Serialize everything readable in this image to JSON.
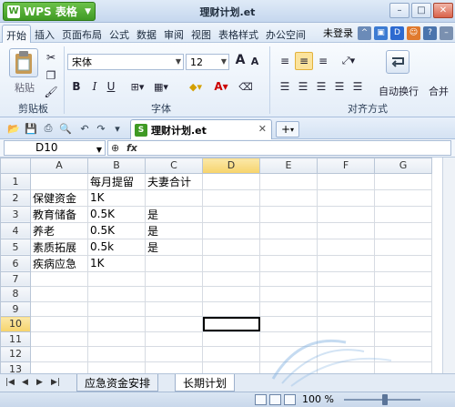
{
  "app": {
    "name": "WPS 表格",
    "window_title": "理财计划.et"
  },
  "menu": {
    "tabs": [
      "开始",
      "插入",
      "页面布局",
      "公式",
      "数据",
      "审阅",
      "视图",
      "表格样式",
      "办公空间"
    ],
    "active_tab": "开始",
    "login_label": "未登录"
  },
  "ribbon": {
    "clipboard": {
      "paste_label": "粘贴",
      "group_label": "剪贴板"
    },
    "font": {
      "font_name": "宋体",
      "font_size": "12",
      "group_label": "字体",
      "bold": "B",
      "italic": "I",
      "underline": "U",
      "grow": "A",
      "shrink": "A"
    },
    "alignment": {
      "wrap_label": "自动换行",
      "merge_label": "合并",
      "group_label": "对齐方式"
    }
  },
  "document_tab": {
    "name": "理财计划.et",
    "add_symbol": "+"
  },
  "formula_bar": {
    "cell_ref": "D10",
    "fx": "fx"
  },
  "sheet": {
    "columns": [
      "A",
      "B",
      "C",
      "D",
      "E",
      "F",
      "G"
    ],
    "rows": [
      [
        "",
        "每月提留",
        "夫妻合计",
        "",
        "",
        "",
        ""
      ],
      [
        "保健资金",
        "1K",
        "",
        "",
        "",
        "",
        ""
      ],
      [
        "教育储备",
        "0.5K",
        "是",
        "",
        "",
        "",
        ""
      ],
      [
        "养老",
        "0.5K",
        "是",
        "",
        "",
        "",
        ""
      ],
      [
        "素质拓展",
        "0.5k",
        "是",
        "",
        "",
        "",
        ""
      ],
      [
        "疾病应急",
        "1K",
        "",
        "",
        "",
        "",
        ""
      ],
      [
        "",
        "",
        "",
        "",
        "",
        "",
        ""
      ],
      [
        "",
        "",
        "",
        "",
        "",
        "",
        ""
      ],
      [
        "",
        "",
        "",
        "",
        "",
        "",
        ""
      ],
      [
        "",
        "",
        "",
        "",
        "",
        "",
        ""
      ],
      [
        "",
        "",
        "",
        "",
        "",
        "",
        ""
      ],
      [
        "",
        "",
        "",
        "",
        "",
        "",
        ""
      ],
      [
        "",
        "",
        "",
        "",
        "",
        "",
        ""
      ]
    ],
    "active_row": 10,
    "active_col": "D"
  },
  "sheet_tabs": [
    "应急资金安排",
    "长期计划"
  ],
  "active_sheet_tab": "长期计划",
  "status": {
    "zoom": "100 %"
  }
}
